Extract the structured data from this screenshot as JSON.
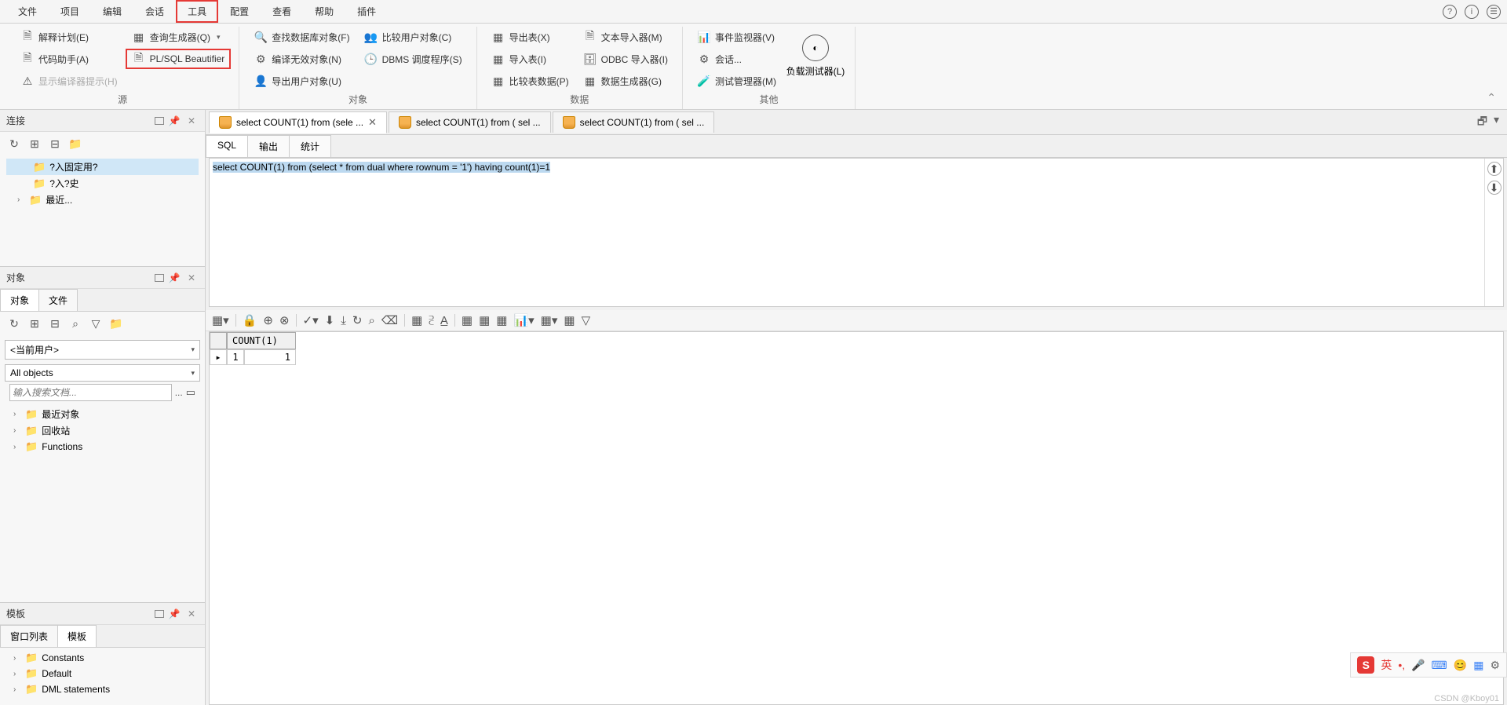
{
  "menu": {
    "file": "文件",
    "project": "项目",
    "edit": "编辑",
    "session": "会话",
    "tools": "工具",
    "config": "配置",
    "view": "查看",
    "help": "帮助",
    "plugins": "插件"
  },
  "help_icons": {
    "q": "?",
    "i": "i",
    "menu": "☰"
  },
  "ribbon": {
    "source": {
      "title": "源",
      "explain": "解释计划(E)",
      "code_assist": "代码助手(A)",
      "show_hint": "显示编译器提示(H)",
      "query_builder": "查询生成器(Q)",
      "beautifier": "PL/SQL Beautifier"
    },
    "objects": {
      "title": "对象",
      "find_db": "查找数据库对象(F)",
      "compile_invalid": "编译无效对象(N)",
      "export_user": "导出用户对象(U)",
      "compare_user": "比较用户对象(C)",
      "dbms_sched": "DBMS 调度程序(S)"
    },
    "data": {
      "title": "数据",
      "export_tables": "导出表(X)",
      "import_tables": "导入表(I)",
      "compare_table": "比较表数据(P)",
      "text_importer": "文本导入器(M)",
      "odbc_importer": "ODBC 导入器(I)",
      "data_gen": "数据生成器(G)"
    },
    "other": {
      "title": "其他",
      "event_monitor": "事件监视器(V)",
      "sessions": "会话...",
      "test_mgr": "测试管理器(M)",
      "load_tester": "负载测试器(L)"
    }
  },
  "panels": {
    "conn": {
      "title": "连接",
      "items": [
        "?入固定用?",
        "?入?史",
        "最近..."
      ]
    },
    "obj": {
      "title": "对象",
      "tabs": [
        "对象",
        "文件"
      ],
      "user": "<当前用户>",
      "scope": "All objects",
      "search_ph": "输入搜索文档...",
      "tree": [
        "最近对象",
        "回收站",
        "Functions"
      ]
    },
    "tpl": {
      "title": "模板",
      "tabs": [
        "窗口列表",
        "模板"
      ],
      "items": [
        "Constants",
        "Default",
        "DML statements"
      ]
    }
  },
  "doc_tabs": [
    "select COUNT(1) from (sele ...",
    "select COUNT(1) from ( sel ...",
    "select COUNT(1) from ( sel ..."
  ],
  "sql_tabs": [
    "SQL",
    "输出",
    "统计"
  ],
  "sql_text": "select COUNT(1) from (select * from dual where rownum = '1') having count(1)=1",
  "grid": {
    "col": "COUNT(1)",
    "row": "1",
    "val": "1"
  },
  "ime": {
    "s": "S",
    "lang": "英",
    "comma": "•,",
    "mic": "🎤",
    "kb": "⌨",
    "face": "😊",
    "apps": "▦",
    "gear": "⚙"
  },
  "watermark": "CSDN @Kboy01"
}
